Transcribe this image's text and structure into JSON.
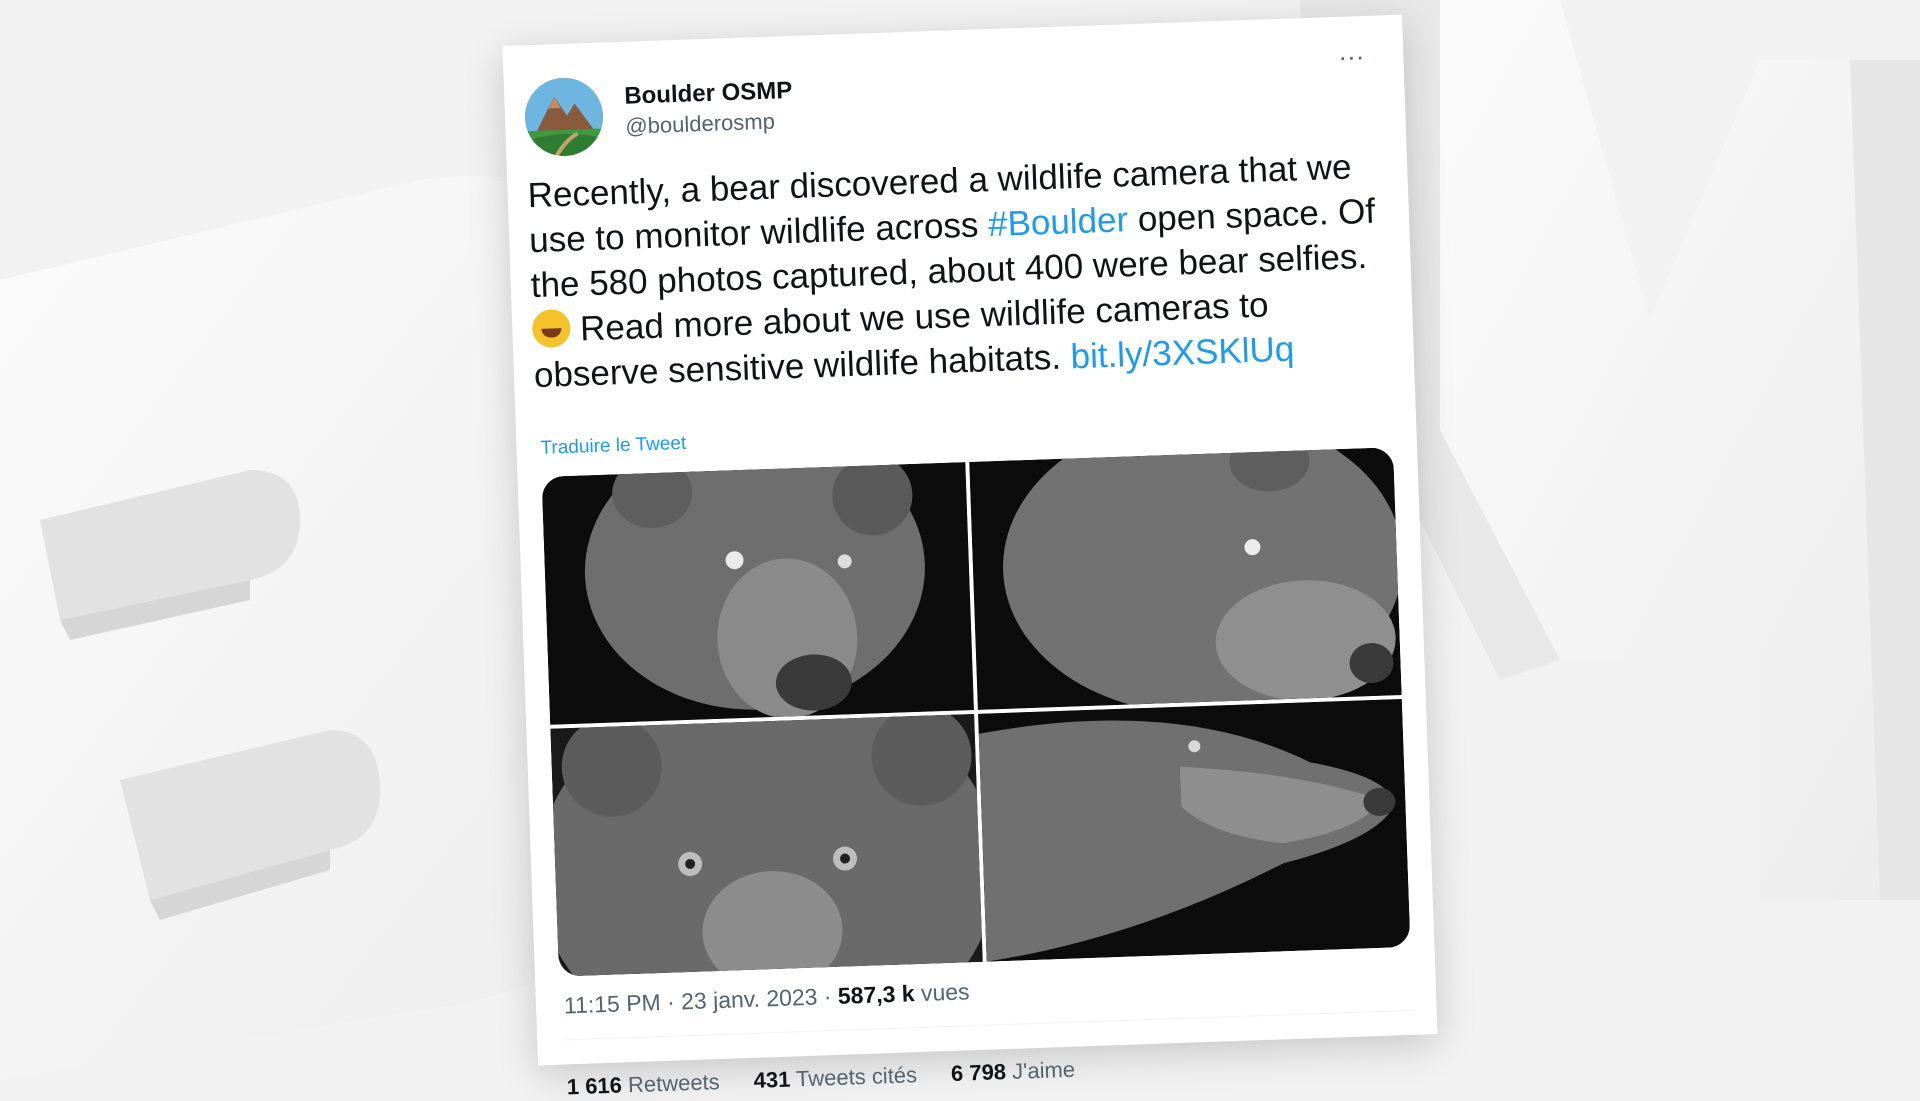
{
  "colors": {
    "accent": "#1d9bf0",
    "text_primary": "#0f1419",
    "text_secondary": "#536471",
    "background": "#f2f2f2"
  },
  "author": {
    "display_name": "Boulder OSMP",
    "handle": "@boulderosmp",
    "avatar_icon": "mountain-logo-icon"
  },
  "menu": {
    "more_label": "···"
  },
  "tweet": {
    "text_1": "Recently, a bear discovered a wildlife camera that we use to monitor wildlife across ",
    "hashtag": "#Boulder",
    "text_2": " open space. Of the 580 photos captured, about 400 were bear selfies.",
    "emoji_icon": "rolling-on-floor-laughing-emoji-icon",
    "text_3": " Read more about we use wildlife cameras to observe sensitive wildlife habitats. ",
    "link": "bit.ly/3XSKlUq",
    "translate_label": "Traduire le Tweet"
  },
  "media": {
    "photos": [
      "bear-photo",
      "bear-photo",
      "bear-photo",
      "bear-photo"
    ]
  },
  "meta": {
    "time_date": "11:15 PM · 23 janv. 2023 · ",
    "views_count": "587,3 k",
    "views_label": " vues"
  },
  "stats": {
    "retweets_count": "1 616",
    "retweets_label": "Retweets",
    "quotes_count": "431",
    "quotes_label": "Tweets cités",
    "likes_count": "6 798",
    "likes_label": "J'aime"
  }
}
